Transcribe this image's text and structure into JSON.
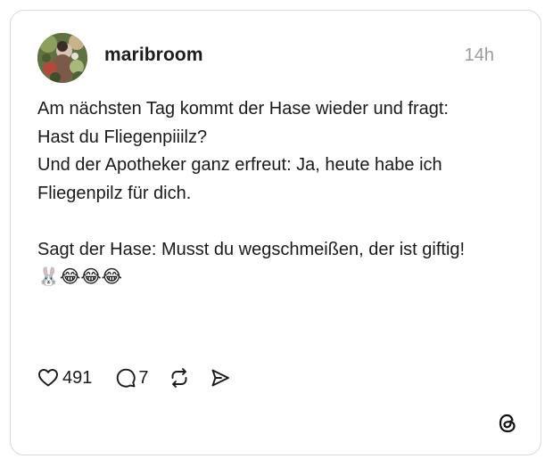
{
  "post": {
    "username": "maribroom",
    "timestamp": "14h",
    "text": "Am nächsten Tag kommt der Hase wieder und fragt:\nHast du Fliegenpiiilz?\nUnd der Apotheker ganz erfreut: Ja, heute habe ich Fliegenpilz für dich.\n\nSagt der Hase: Musst du wegschmeißen, der ist giftig!\n🐰😂😂😂",
    "like_count": "491",
    "reply_count": "7"
  },
  "icons": {
    "avatar": "profile-photo",
    "like": "heart-outline-icon",
    "reply": "speech-bubble-icon",
    "repost": "repost-arrows-icon",
    "share": "paper-plane-icon",
    "brand": "threads-logo-icon"
  },
  "colors": {
    "text": "#1a1a1a",
    "muted": "#9a9a9a",
    "border": "#d9d9d9"
  }
}
